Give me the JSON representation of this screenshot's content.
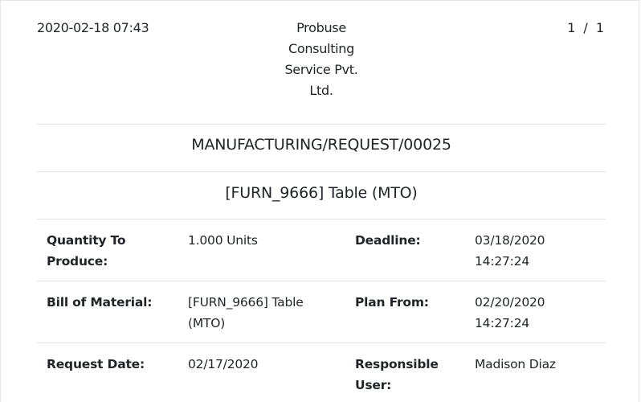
{
  "header": {
    "print_datetime": "2020-02-18 07:43",
    "company_lines": [
      "Probuse",
      "Consulting",
      "Service Pvt.",
      "Ltd."
    ],
    "page_current": "1",
    "page_sep": "/",
    "page_total": "1"
  },
  "document": {
    "reference": "MANUFACTURING/REQUEST/00025",
    "product": "[FURN_9666] Table (MTO)"
  },
  "fields": {
    "quantity": {
      "label_lines": [
        "Quantity To",
        "Produce:"
      ],
      "value_lines": [
        "1.000 Units"
      ]
    },
    "deadline": {
      "label_lines": [
        "Deadline:"
      ],
      "value_lines": [
        "03/18/2020",
        "14:27:24"
      ]
    },
    "bom": {
      "label_lines": [
        "Bill of Material:"
      ],
      "value_lines": [
        "[FURN_9666] Table",
        "(MTO)"
      ]
    },
    "plan_from": {
      "label_lines": [
        "Plan From:"
      ],
      "value_lines": [
        "02/20/2020",
        "14:27:24"
      ]
    },
    "request_date": {
      "label_lines": [
        "Request Date:"
      ],
      "value_lines": [
        "02/17/2020"
      ]
    },
    "responsible": {
      "label_lines": [
        "Responsible",
        "User:"
      ],
      "value_lines": [
        "Madison Diaz"
      ]
    }
  }
}
